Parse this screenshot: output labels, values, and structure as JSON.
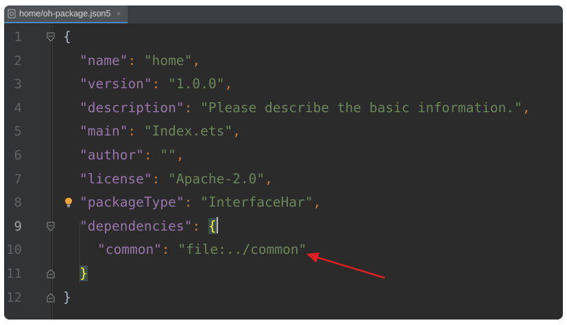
{
  "tab": {
    "label": "home/oh-package.json5",
    "close": "×"
  },
  "lines": [
    {
      "num": "1",
      "tokens": [
        {
          "t": "{",
          "c": "brace"
        }
      ]
    },
    {
      "num": "2",
      "tokens": [
        {
          "t": "\"name\"",
          "c": "key"
        },
        {
          "t": ": ",
          "c": "punc"
        },
        {
          "t": "\"home\"",
          "c": "str"
        },
        {
          "t": ",",
          "c": "punc"
        }
      ]
    },
    {
      "num": "3",
      "tokens": [
        {
          "t": "\"version\"",
          "c": "key"
        },
        {
          "t": ": ",
          "c": "punc"
        },
        {
          "t": "\"1.0.0\"",
          "c": "str"
        },
        {
          "t": ",",
          "c": "punc"
        }
      ]
    },
    {
      "num": "4",
      "tokens": [
        {
          "t": "\"description\"",
          "c": "key"
        },
        {
          "t": ": ",
          "c": "punc"
        },
        {
          "t": "\"Please describe the basic information.\"",
          "c": "str"
        },
        {
          "t": ",",
          "c": "punc"
        }
      ]
    },
    {
      "num": "5",
      "tokens": [
        {
          "t": "\"main\"",
          "c": "key"
        },
        {
          "t": ": ",
          "c": "punc"
        },
        {
          "t": "\"Index.ets\"",
          "c": "str"
        },
        {
          "t": ",",
          "c": "punc"
        }
      ]
    },
    {
      "num": "6",
      "tokens": [
        {
          "t": "\"author\"",
          "c": "key"
        },
        {
          "t": ": ",
          "c": "punc"
        },
        {
          "t": "\"\"",
          "c": "str"
        },
        {
          "t": ",",
          "c": "punc"
        }
      ]
    },
    {
      "num": "7",
      "tokens": [
        {
          "t": "\"license\"",
          "c": "key"
        },
        {
          "t": ": ",
          "c": "punc"
        },
        {
          "t": "\"Apache-2.0\"",
          "c": "str"
        },
        {
          "t": ",",
          "c": "punc"
        }
      ]
    },
    {
      "num": "8",
      "tokens": [
        {
          "t": "\"packageType\"",
          "c": "key"
        },
        {
          "t": ": ",
          "c": "punc"
        },
        {
          "t": "\"InterfaceHar\"",
          "c": "str"
        },
        {
          "t": ",",
          "c": "punc"
        }
      ]
    },
    {
      "num": "9",
      "tokens": [
        {
          "t": "\"dependencies\"",
          "c": "key"
        },
        {
          "t": ": ",
          "c": "punc"
        },
        {
          "t": "{",
          "c": "brace-hl"
        }
      ]
    },
    {
      "num": "10",
      "tokens": [
        {
          "t": "\"common\"",
          "c": "key"
        },
        {
          "t": ": ",
          "c": "punc"
        },
        {
          "t": "\"file:../common\"",
          "c": "str"
        }
      ]
    },
    {
      "num": "11",
      "tokens": [
        {
          "t": "}",
          "c": "brace-hl"
        }
      ]
    },
    {
      "num": "12",
      "tokens": [
        {
          "t": "}",
          "c": "brace"
        }
      ]
    }
  ],
  "active_line": "9",
  "colors": {
    "background": "#2b2b2b",
    "key": "#9876aa",
    "string": "#6a8759",
    "punctuation": "#cc7832",
    "annotation_arrow": "#e02020"
  },
  "icons": {
    "file": "json-file-icon",
    "bulb": "lightbulb-icon",
    "fold": "fold-icon",
    "arrow": "annotation-arrow"
  }
}
